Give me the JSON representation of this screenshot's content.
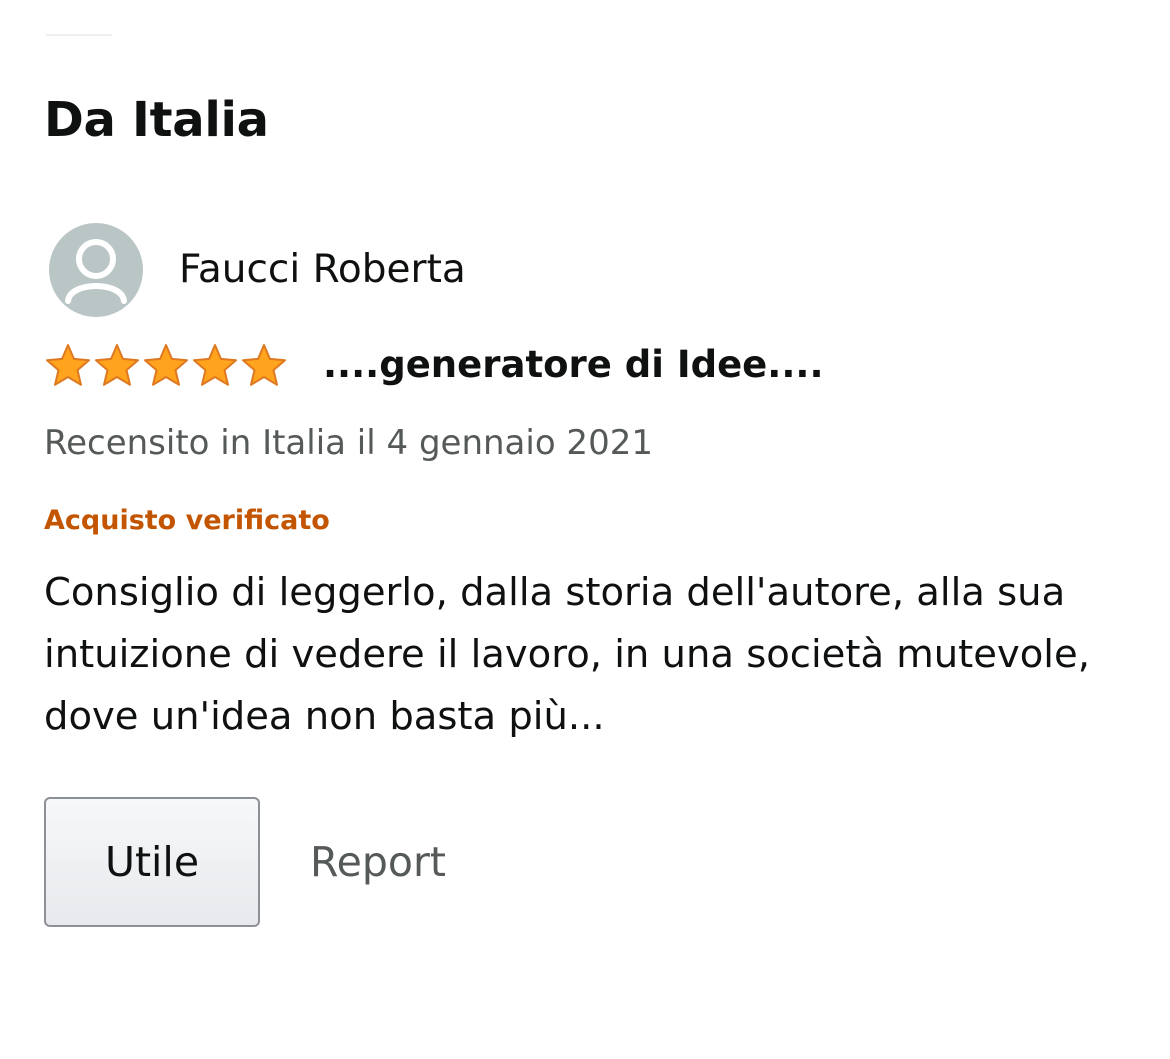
{
  "section": {
    "title": "Da Italia"
  },
  "review": {
    "author": "Faucci Roberta",
    "avatar_icon": "person-icon",
    "rating": 5,
    "rating_max": 5,
    "star_icon": "star-icon",
    "star_color": "#ffa41c",
    "title": "....generatore di Idee....",
    "date_text": "Recensito in Italia il 4 gennaio 2021",
    "verified_label": "Acquisto verificato",
    "verified_color": "#c45500",
    "body": "Consiglio di leggerlo, dalla storia dell'autore, alla sua intuizione di vedere il lavoro, in una società mutevole, dove un'idea non basta più..."
  },
  "actions": {
    "helpful_label": "Utile",
    "report_label": "Report"
  }
}
